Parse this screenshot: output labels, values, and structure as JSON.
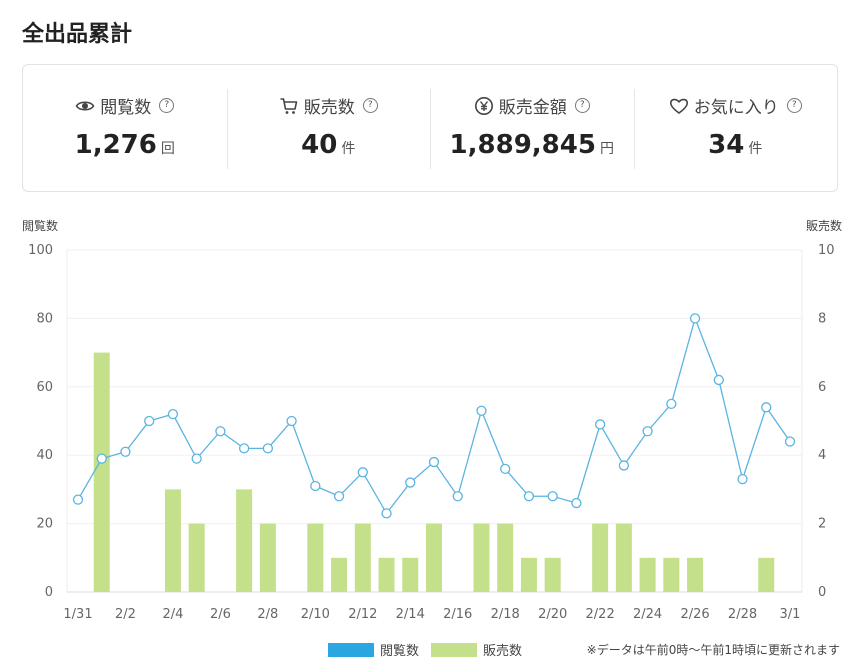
{
  "page": {
    "title": "全出品累計"
  },
  "stats": [
    {
      "icon": "eye-icon",
      "label": "閲覧数",
      "value": "1,276",
      "unit": "回"
    },
    {
      "icon": "cart-icon",
      "label": "販売数",
      "value": "40",
      "unit": "件"
    },
    {
      "icon": "yen-icon",
      "label": "販売金額",
      "value": "1,889,845",
      "unit": "円"
    },
    {
      "icon": "heart-icon",
      "label": "お気に入り",
      "value": "34",
      "unit": "件"
    }
  ],
  "help_mark": "?",
  "chart_data": {
    "type": "bar",
    "categories": [
      "1/31",
      "2/1",
      "2/2",
      "2/3",
      "2/4",
      "2/5",
      "2/6",
      "2/7",
      "2/8",
      "2/9",
      "2/10",
      "2/11",
      "2/12",
      "2/13",
      "2/14",
      "2/15",
      "2/16",
      "2/17",
      "2/18",
      "2/19",
      "2/20",
      "2/21",
      "2/22",
      "2/23",
      "2/24",
      "2/25",
      "2/26",
      "2/27",
      "2/28",
      "2/29",
      "3/1"
    ],
    "tick_labels": [
      "1/31",
      "2/2",
      "2/4",
      "2/6",
      "2/8",
      "2/10",
      "2/12",
      "2/14",
      "2/16",
      "2/18",
      "2/20",
      "2/22",
      "2/24",
      "2/26",
      "2/28",
      "3/1"
    ],
    "series": [
      {
        "name": "閲覧数",
        "type": "line",
        "axis": "left",
        "values": [
          27,
          39,
          41,
          50,
          52,
          39,
          47,
          42,
          42,
          50,
          31,
          28,
          35,
          23,
          32,
          38,
          28,
          53,
          36,
          28,
          28,
          26,
          49,
          37,
          47,
          55,
          80,
          62,
          33,
          54,
          44
        ]
      },
      {
        "name": "販売数",
        "type": "bar",
        "axis": "right",
        "values": [
          0,
          7,
          0,
          0,
          3,
          2,
          0,
          3,
          2,
          0,
          2,
          1,
          2,
          1,
          1,
          2,
          0,
          2,
          2,
          1,
          1,
          0,
          2,
          2,
          1,
          1,
          1,
          0,
          0,
          1,
          0
        ]
      }
    ],
    "ylabel_left": "閲覧数",
    "ylabel_right": "販売数",
    "ylim_left": [
      0,
      100
    ],
    "ylim_right": [
      0,
      10
    ],
    "yticks_left": [
      0,
      20,
      40,
      60,
      80,
      100
    ],
    "yticks_right": [
      0,
      2,
      4,
      6,
      8,
      10
    ],
    "grid": true,
    "colors": {
      "line": "#5bb4e0",
      "bar": "#c5e08a",
      "legend_line": "#2aa6e0",
      "legend_bar": "#c5e08a"
    },
    "legend": "bottom-center"
  },
  "note": "※データは午前0時〜午前1時頃に更新されます"
}
